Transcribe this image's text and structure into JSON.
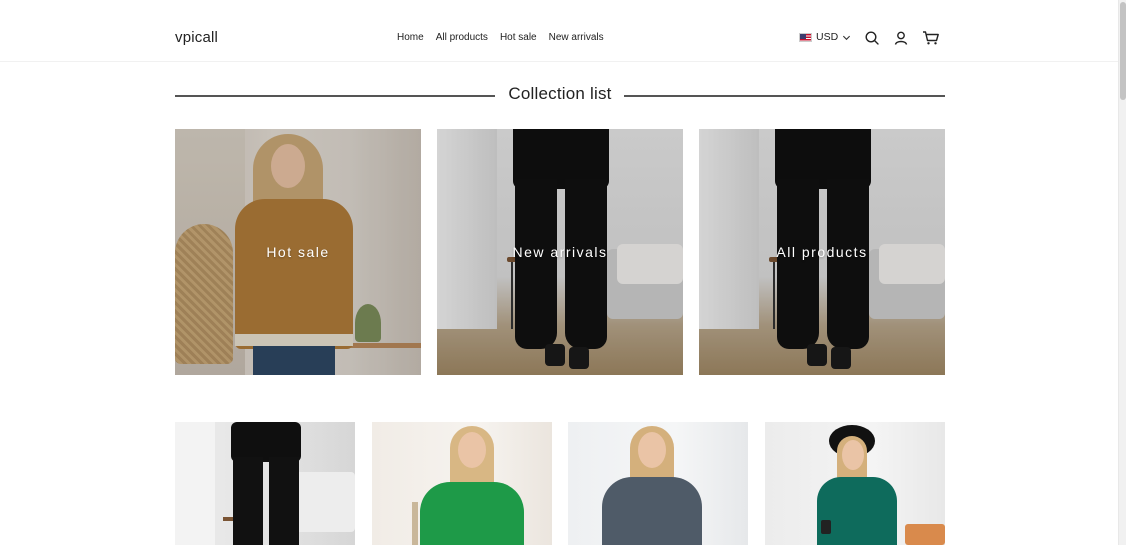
{
  "header": {
    "logo": "vpicall",
    "nav": [
      "Home",
      "All products",
      "Hot sale",
      "New arrivals"
    ],
    "currency": "USD",
    "icons": [
      "search-icon",
      "account-icon",
      "cart-icon"
    ]
  },
  "section": {
    "title": "Collection list"
  },
  "collections": [
    {
      "label": "Hot sale"
    },
    {
      "label": "New arrivals"
    },
    {
      "label": "All products"
    }
  ],
  "products_row": [
    {
      "image": "black-flare-pants"
    },
    {
      "image": "green-sweater"
    },
    {
      "image": "grey-sweater"
    },
    {
      "image": "teal-dress"
    }
  ],
  "colors": {
    "text": "#222222",
    "line": "#555555",
    "overlay_text": "#ffffff"
  }
}
